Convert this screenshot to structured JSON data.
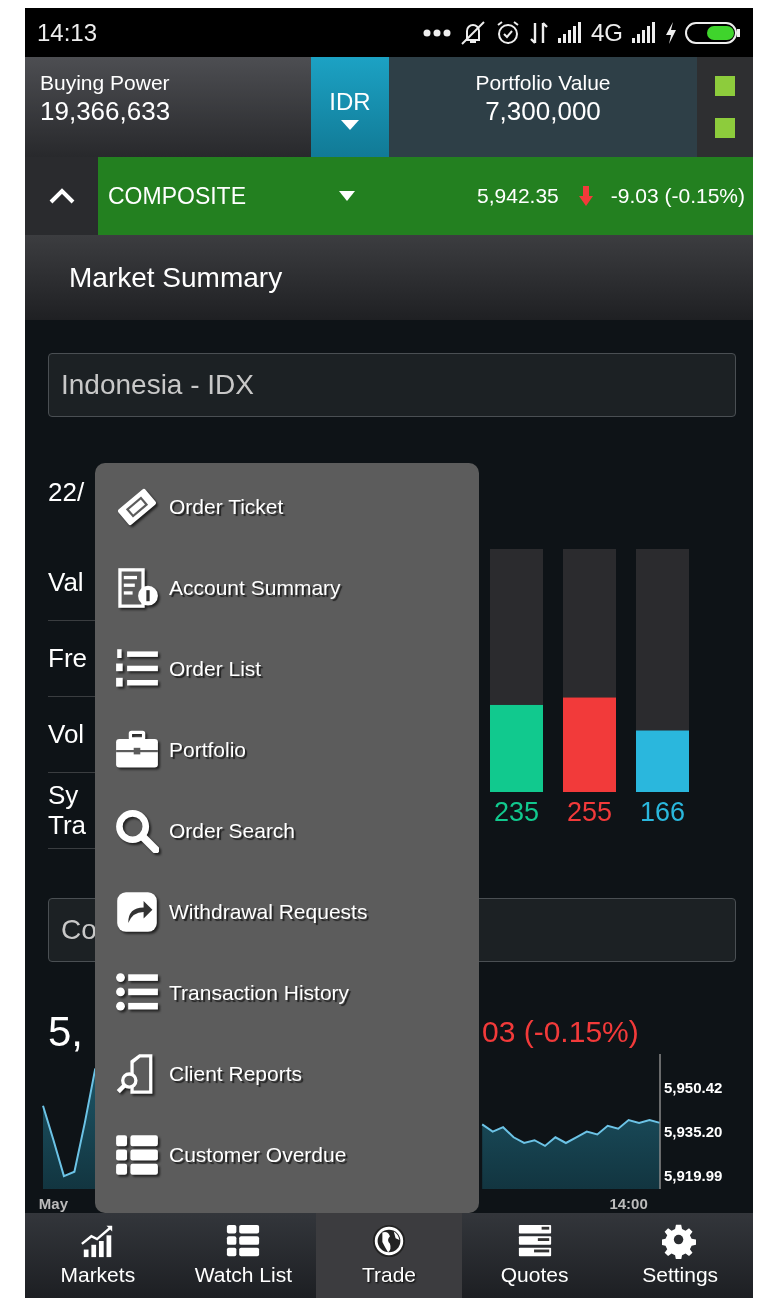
{
  "status_bar": {
    "time": "14:13",
    "network": "4G"
  },
  "account": {
    "buying_power_label": "Buying Power",
    "buying_power": "19,366,633",
    "currency": "IDR",
    "portfolio_value_label": "Portfolio Value",
    "portfolio_value": "7,300,000"
  },
  "index_bar": {
    "name": "COMPOSITE",
    "value": "5,942.35",
    "change": "-9.03 (-0.15%)"
  },
  "page_title": "Market Summary",
  "market_select": {
    "value": "Indonesia - IDX"
  },
  "summary": {
    "date": "22/",
    "rows": [
      {
        "lines": [
          "Val"
        ]
      },
      {
        "lines": [
          "Fre"
        ]
      },
      {
        "lines": [
          "Vol"
        ]
      },
      {
        "lines": [
          "Sy",
          "Tra"
        ]
      }
    ]
  },
  "breadth_chart": {
    "chart_data": {
      "type": "bar",
      "values": [
        235,
        255,
        166
      ],
      "colors": [
        "#11c98e",
        "#f23a3a",
        "#2ab7dd"
      ],
      "ylim": [
        0,
        656
      ],
      "data_labels": true
    }
  },
  "index_select": {
    "value": "Co"
  },
  "index_price": {
    "value": "5,",
    "change": "03 (-0.15%)"
  },
  "index_chart": {
    "chart_data": {
      "type": "area",
      "categories": [
        null,
        "May",
        null,
        null,
        null,
        null,
        null,
        null,
        null,
        null,
        null,
        null,
        null,
        null,
        null,
        null,
        null,
        null,
        null,
        null,
        null,
        null,
        null,
        null,
        null,
        null,
        null,
        null,
        null,
        null,
        null,
        null,
        null,
        null,
        null,
        null,
        null,
        null,
        null,
        null,
        null,
        null,
        null,
        null,
        null,
        null,
        null,
        null,
        null,
        null,
        null,
        null,
        null,
        null,
        null,
        null,
        "14:00",
        null,
        null,
        null
      ],
      "series": [
        {
          "color": "#6cc3e6",
          "values": [
            5944,
            5932,
            5919.5,
            5921,
            5938,
            5957,
            null,
            null,
            null,
            null,
            null,
            null,
            null,
            null,
            null,
            null,
            null,
            null,
            null,
            null,
            null,
            null,
            null,
            null,
            null,
            null,
            null,
            null,
            null,
            null,
            null,
            null,
            null,
            null,
            null,
            null,
            null,
            null,
            null,
            null,
            null,
            null,
            5937.5,
            5935,
            5936.5,
            5933,
            5931,
            5932,
            5930,
            5933,
            5931,
            5933,
            5935,
            5934,
            5937,
            5936,
            5939,
            5938,
            5939,
            5938
          ]
        }
      ],
      "ylim": [
        5915,
        5962
      ],
      "yticks": [
        {
          "value": 5950.42,
          "label": "5,950.42"
        },
        {
          "value": 5935.2,
          "label": "5,935.20"
        },
        {
          "value": 5919.99,
          "label": "5,919.99"
        }
      ]
    }
  },
  "menu": {
    "items": [
      {
        "label": "Order Ticket"
      },
      {
        "label": "Account Summary"
      },
      {
        "label": "Order List"
      },
      {
        "label": "Portfolio"
      },
      {
        "label": "Order Search"
      },
      {
        "label": "Withdrawal Requests"
      },
      {
        "label": "Transaction History"
      },
      {
        "label": "Client Reports"
      },
      {
        "label": "Customer Overdue"
      }
    ]
  },
  "bottom_nav": [
    {
      "label": "Markets",
      "selected": false
    },
    {
      "label": "Watch List",
      "selected": false
    },
    {
      "label": "Trade",
      "selected": true
    },
    {
      "label": "Quotes",
      "selected": false
    },
    {
      "label": "Settings",
      "selected": false
    }
  ]
}
